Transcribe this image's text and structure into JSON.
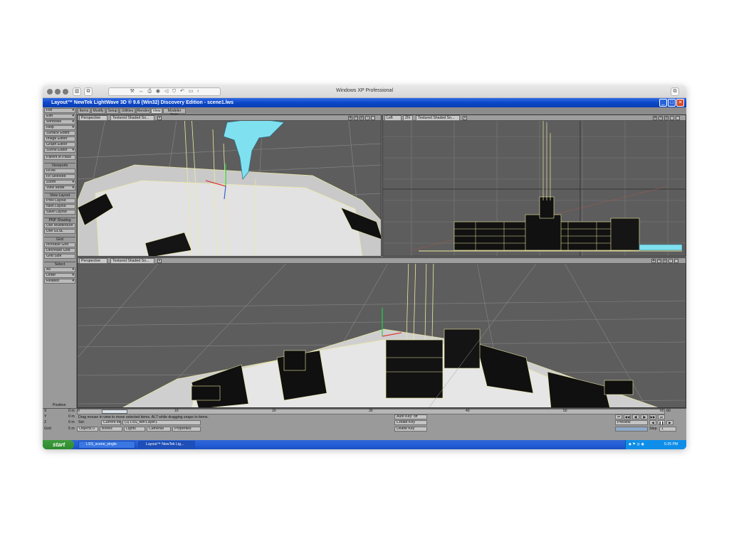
{
  "host": {
    "title": "Windows XP Professional",
    "toolbar_icons": [
      "wrench-icon",
      "arrows-icon",
      "print-icon",
      "camera-icon",
      "speaker-icon",
      "shield-icon",
      "undo-icon",
      "folder-icon",
      "back-icon"
    ]
  },
  "app": {
    "title": "Layout™ NewTek LightWave 3D ® 9.6  (Win32) Discovery Edition - scene1.lws",
    "tabs": [
      "Items",
      "Modify",
      "Setup",
      "Utilities",
      "Render",
      "View",
      "Modeler Tools"
    ],
    "active_tab": "View"
  },
  "left_panel": {
    "menus": [
      "File",
      "Edit",
      "Windows",
      "Help"
    ],
    "editors": [
      "Surface Editor",
      "Image Editor",
      "Graph Editor",
      "Scene Editor"
    ],
    "parent_in_place": "Parent in Place",
    "viewports": {
      "header": "Viewports",
      "items": [
        "Fit All",
        "Fit Selected",
        "Zoom",
        "View Mode"
      ]
    },
    "view_layout": {
      "header": "View Layout",
      "items": [
        "Prev Layout",
        "Next Layout",
        "Save Layout"
      ]
    },
    "shading": {
      "header": "PNP Shading",
      "items": [
        "Use Multitexture",
        "Use GLSL"
      ]
    },
    "grid": {
      "header": "Grid",
      "items": [
        "Increase Grid",
        "Decrease Grid",
        "Grid Size"
      ]
    },
    "select": {
      "header": "Select",
      "items": [
        "All",
        "Order",
        "Related"
      ]
    }
  },
  "viewports": {
    "top_left": {
      "view": "Perspective",
      "shading": "Textured Shaded So..."
    },
    "top_right": {
      "view": "Left",
      "zn": "ZN",
      "shading": "Textured Shaded So..."
    },
    "bottom": {
      "view": "Perspective",
      "shading": "Textured Shaded So..."
    }
  },
  "bottom": {
    "position_label": "Position",
    "x": {
      "label": "X",
      "value": "0 m"
    },
    "y": {
      "label": "Y",
      "value": "0 m"
    },
    "z": {
      "label": "Z",
      "value": "0 m"
    },
    "grid": {
      "label": "Grid",
      "value": "5 m"
    },
    "timeline_ticks": [
      "0",
      "10",
      "20",
      "30",
      "40",
      "50",
      "60"
    ],
    "timeline_end": "60",
    "current_frame": 0,
    "frame_count": 60,
    "status": "Drag mouse in view to move selected items. ALT while dragging snaps to items.",
    "sel": "Sel:",
    "current_item_label": "Current Item",
    "current_item": "(1) LSS_fwn:Layer1",
    "objects": "Objects",
    "objects_count": "0",
    "bones": "Bones",
    "lights": "Lights",
    "cameras": "Cameras",
    "properties": "Properties",
    "auto_key": "Auto Key:",
    "auto_key_value": "off",
    "create_key": "Create Key",
    "delete_key": "Delete Key",
    "preview": "Preview",
    "step_label": "Step",
    "step_value": "1"
  },
  "taskbar": {
    "start": "start",
    "tasks": [
      "LSS_scene_single",
      "Layout™ NewTek Lig..."
    ],
    "time": "5:25 PM"
  },
  "colors": {
    "xp_blue": "#245ed8",
    "viewport_bg": "#5f5f5f",
    "wireframe": "#ece9a0",
    "selection": "#7fe0f0"
  }
}
